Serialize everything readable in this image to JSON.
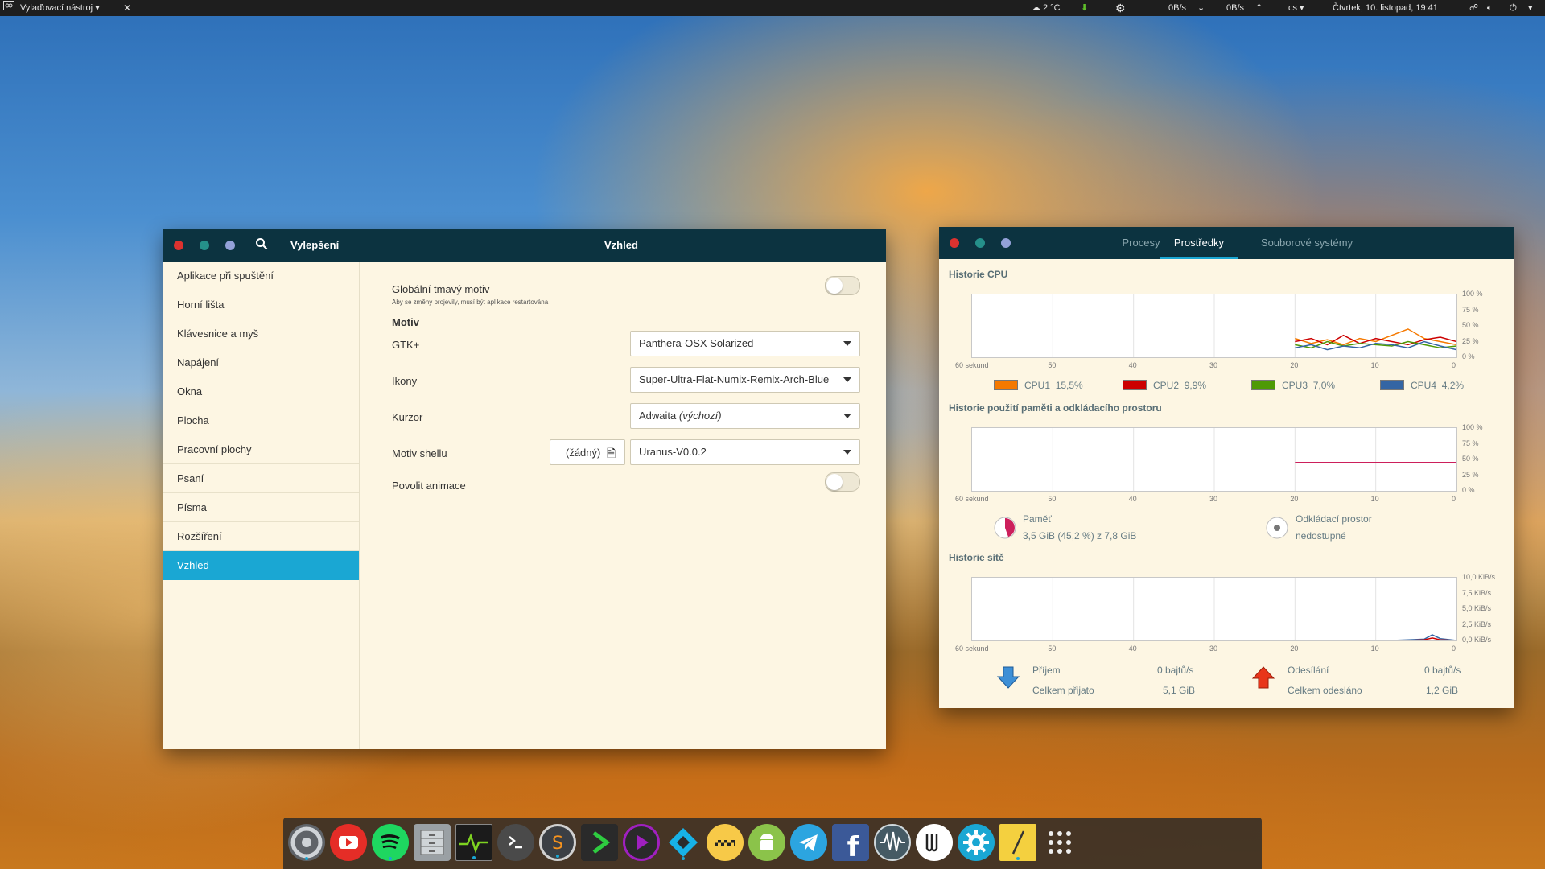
{
  "topbar": {
    "app_menu": "Vylaďovací nástroj",
    "weather": "2 °C",
    "net_down": "0B/s",
    "net_up": "0B/s",
    "keyboard": "cs",
    "clock": "Čtvrtek, 10. listopad, 19:41"
  },
  "tweaks": {
    "title_left": "Vylepšení",
    "title_center": "Vzhled",
    "sidebar": [
      "Aplikace při spuštění",
      "Horní lišta",
      "Klávesnice a myš",
      "Napájení",
      "Okna",
      "Plocha",
      "Pracovní plochy",
      "Psaní",
      "Písma",
      "Rozšíření",
      "Vzhled"
    ],
    "active_item": "Vzhled",
    "dark_theme": {
      "label": "Globální tmavý motiv",
      "note": "Aby se změny projevily, musí být aplikace restartována",
      "enabled": false
    },
    "section_title": "Motiv",
    "gtk": {
      "label": "GTK+",
      "value": "Panthera-OSX Solarized"
    },
    "icons": {
      "label": "Ikony",
      "value": "Super-Ultra-Flat-Numix-Remix-Arch-Blue"
    },
    "cursor": {
      "label": "Kurzor",
      "value": "Adwaita",
      "default_tag": "(výchozí)"
    },
    "shell": {
      "label": "Motiv shellu",
      "file_button": "(žádný)",
      "value": "Uranus-V0.0.2"
    },
    "animations": {
      "label": "Povolit animace",
      "enabled": false
    }
  },
  "monitor": {
    "tabs": [
      "Procesy",
      "Prostředky",
      "Souborové systémy"
    ],
    "active_tab": "Prostředky",
    "cpu_title": "Historie CPU",
    "mem_title": "Historie použití paměti a odkládacího prostoru",
    "net_title": "Historie sítě",
    "x_ticks": [
      "60 sekund",
      "50",
      "40",
      "30",
      "20",
      "10",
      "0"
    ],
    "pct_ticks": [
      "100 %",
      "75 %",
      "50 %",
      "25 %",
      "0 %"
    ],
    "net_ticks": [
      "10,0 KiB/s",
      "7,5 KiB/s",
      "5,0 KiB/s",
      "2,5 KiB/s",
      "0,0 KiB/s"
    ],
    "cpus": [
      {
        "name": "CPU1",
        "value": "15,5%",
        "color": "#f57900"
      },
      {
        "name": "CPU2",
        "value": "9,9%",
        "color": "#cc0000"
      },
      {
        "name": "CPU3",
        "value": "7,0%",
        "color": "#4e9a06"
      },
      {
        "name": "CPU4",
        "value": "4,2%",
        "color": "#3465a4"
      }
    ],
    "memory": {
      "label": "Paměť",
      "value": "3,5 GiB (45,2 %) z 7,8 GiB",
      "color": "#cc1f5b"
    },
    "swap": {
      "label": "Odkládací prostor",
      "value": "nedostupné"
    },
    "net": {
      "recv_label": "Příjem",
      "recv_rate": "0 bajtů/s",
      "recv_total_label": "Celkem přijato",
      "recv_total": "5,1 GiB",
      "sent_label": "Odesílání",
      "sent_rate": "0 bajtů/s",
      "sent_total_label": "Celkem odesláno",
      "sent_total": "1,2 GiB"
    }
  },
  "dock_apps": [
    "chrome-icon",
    "youtube-icon",
    "spotify-icon",
    "files-icon",
    "system-monitor-icon",
    "terminal-icon",
    "sublime-icon",
    "play-icon",
    "media-player-icon",
    "kodi-icon",
    "taxi-icon",
    "android-icon",
    "telegram-icon",
    "facebook-icon",
    "waveform-icon",
    "wunderlist-icon",
    "settings-icon",
    "notes-icon",
    "app-grid-icon"
  ],
  "chart_data": [
    {
      "type": "line",
      "title": "Historie CPU",
      "xlabel": "",
      "ylabel": "",
      "x": [
        20,
        18,
        16,
        14,
        12,
        10,
        8,
        6,
        4,
        2,
        0
      ],
      "ylim": [
        0,
        100
      ],
      "series": [
        {
          "name": "CPU1",
          "values": [
            30,
            22,
            28,
            20,
            30,
            25,
            35,
            45,
            30,
            25,
            20
          ]
        },
        {
          "name": "CPU2",
          "values": [
            25,
            30,
            20,
            35,
            22,
            30,
            25,
            20,
            28,
            32,
            25
          ]
        },
        {
          "name": "CPU3",
          "values": [
            20,
            15,
            25,
            18,
            22,
            20,
            18,
            25,
            20,
            15,
            18
          ]
        },
        {
          "name": "CPU4",
          "values": [
            15,
            20,
            12,
            18,
            15,
            22,
            20,
            15,
            25,
            18,
            12
          ]
        }
      ]
    },
    {
      "type": "line",
      "title": "Historie použití paměti a odkládacího prostoru",
      "x": [
        20,
        0
      ],
      "ylim": [
        0,
        100
      ],
      "series": [
        {
          "name": "Paměť",
          "values": [
            45.2,
            45.2
          ]
        }
      ]
    },
    {
      "type": "line",
      "title": "Historie sítě",
      "x": [
        20,
        8,
        6,
        4,
        3,
        2,
        0
      ],
      "ylim": [
        0,
        10
      ],
      "series": [
        {
          "name": "Příjem",
          "values": [
            0,
            0,
            0.1,
            0.2,
            0.9,
            0.3,
            0
          ]
        },
        {
          "name": "Odesílání",
          "values": [
            0,
            0,
            0,
            0.1,
            0.4,
            0.1,
            0
          ]
        }
      ]
    }
  ]
}
